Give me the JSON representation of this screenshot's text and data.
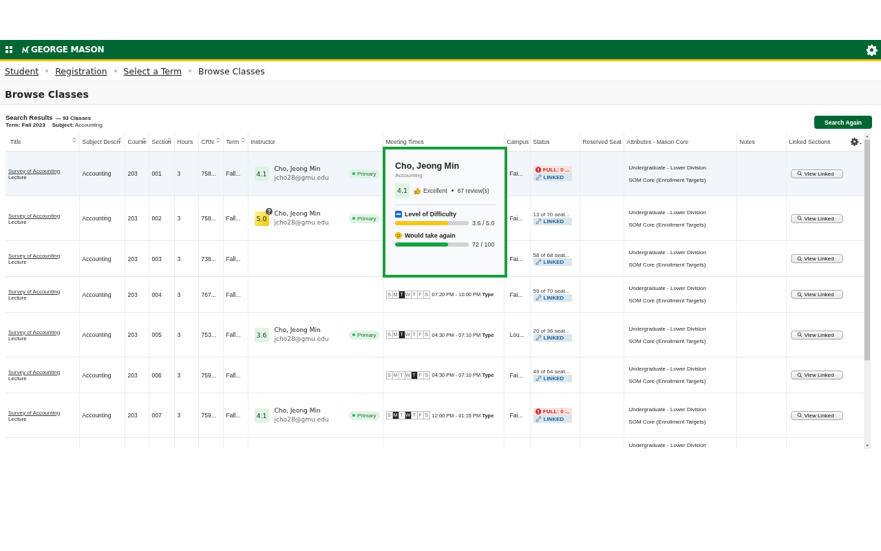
{
  "header": {
    "logo": "GEORGE MASON"
  },
  "breadcrumb": [
    {
      "label": "Student",
      "link": true
    },
    {
      "label": "Registration",
      "link": true
    },
    {
      "label": "Select a Term",
      "link": true
    },
    {
      "label": "Browse Classes",
      "link": false
    }
  ],
  "page_title": "Browse Classes",
  "results": {
    "title": "Search Results",
    "count": "— 93 Classes",
    "term": "Term: Fall 2023",
    "subject": "**Subject:** Accounting",
    "button": "Search Again"
  },
  "columns": [
    {
      "label": "Title",
      "sortable": true
    },
    {
      "label": "Subject Descri",
      "sortable": true
    },
    {
      "label": "Course",
      "sortable": true
    },
    {
      "label": "Section",
      "sortable": true
    },
    {
      "label": "Hours",
      "sortable": false
    },
    {
      "label": "CRN",
      "sortable": true
    },
    {
      "label": "Term",
      "sortable": true
    },
    {
      "label": "Instructor",
      "sortable": false
    },
    {
      "label": "Meeting Times",
      "sortable": false
    },
    {
      "label": "Campus",
      "sortable": false
    },
    {
      "label": "Status",
      "sortable": false
    },
    {
      "label": "Reserved Seat",
      "sortable": false
    },
    {
      "label": "Attributes - Mason Core",
      "sortable": false
    },
    {
      "label": "Notes",
      "sortable": false
    },
    {
      "label": "Linked Sections",
      "sortable": false
    }
  ],
  "rows": [
    {
      "selected": true,
      "title": "Survey of Accounting",
      "schedule": "Lecture",
      "subject": "Accounting",
      "course": "203",
      "section": "001",
      "hours": "3",
      "crn": "758...",
      "term": "Fall...",
      "instructor": {
        "rating": "4.1",
        "kind": "rated",
        "name": "Cho, Jeong Min",
        "email": "jcho28@gmu.edu",
        "role": "Primary"
      },
      "campus": "Fai...",
      "status": [
        {
          "kind": "full",
          "text": "FULL: 0 ..."
        },
        {
          "kind": "linked",
          "text": "LINKED"
        }
      ],
      "attributes": [
        "Undergraduate - Lower Division",
        "SOM Core (Enrollment Targets)"
      ],
      "linked": "View Linked"
    },
    {
      "selected": false,
      "title": "Survey of Accounting",
      "schedule": "Lecture",
      "subject": "Accounting",
      "course": "203",
      "section": "002",
      "hours": "3",
      "crn": "758...",
      "term": "Fall...",
      "instructor": {
        "rating": "5.0",
        "kind": "unverified",
        "name": "Cho, Jeong Min",
        "email": "jcho28@gmu.edu",
        "role": "Primary"
      },
      "campus": "Fai...",
      "status": [
        {
          "kind": "seats",
          "text": "13 of 70 seat..."
        },
        {
          "kind": "linked",
          "text": "LINKED"
        }
      ],
      "attributes": [
        "Undergraduate - Lower Division",
        "SOM Core (Enrollment Targets)"
      ],
      "linked": "View Linked"
    },
    {
      "selected": false,
      "title": "Survey of Accounting",
      "schedule": "Lecture",
      "subject": "Accounting",
      "course": "203",
      "section": "003",
      "hours": "3",
      "crn": "738...",
      "term": "Fall...",
      "campus": "Fai...",
      "status": [
        {
          "kind": "seats",
          "text": "58 of 68 seat..."
        },
        {
          "kind": "linked",
          "text": "LINKED"
        }
      ],
      "attributes": [
        "Undergraduate - Lower Division",
        "SOM Core (Enrollment Targets)"
      ],
      "linked": "View Linked"
    },
    {
      "selected": false,
      "title": "Survey of Accounting",
      "schedule": "Lecture",
      "subject": "Accounting",
      "course": "203",
      "section": "004",
      "hours": "3",
      "crn": "767...",
      "term": "Fall...",
      "meeting": {
        "days": [
          {
            "label": "S",
            "on": false
          },
          {
            "label": "M",
            "on": false
          },
          {
            "label": "T",
            "on": true
          },
          {
            "label": "W",
            "on": false
          },
          {
            "label": "T",
            "on": false
          },
          {
            "label": "F",
            "on": false
          },
          {
            "label": "S",
            "on": false
          }
        ],
        "time": "07:20 PM - 10:00 PM",
        "type": "Type"
      },
      "campus": "Fai...",
      "status": [
        {
          "kind": "seats",
          "text": "59 of 70 seat..."
        },
        {
          "kind": "linked",
          "text": "LINKED"
        }
      ],
      "attributes": [
        "Undergraduate - Lower Division",
        "SOM Core (Enrollment Targets)"
      ],
      "linked": "View Linked"
    },
    {
      "selected": false,
      "title": "Survey of Accounting",
      "schedule": "Lecture",
      "subject": "Accounting",
      "course": "203",
      "section": "005",
      "hours": "3",
      "crn": "753...",
      "term": "Fall...",
      "instructor": {
        "rating": "3.6",
        "kind": "rated",
        "name": "Cho, Jeong Min",
        "email": "jcho28@gmu.edu",
        "role": "Primary"
      },
      "meeting": {
        "days": [
          {
            "label": "S",
            "on": false
          },
          {
            "label": "M",
            "on": false
          },
          {
            "label": "T",
            "on": true
          },
          {
            "label": "W",
            "on": false
          },
          {
            "label": "T",
            "on": false
          },
          {
            "label": "F",
            "on": false
          },
          {
            "label": "S",
            "on": false
          }
        ],
        "time": "04:30 PM - 07:10 PM",
        "type": "Type"
      },
      "campus": "Lou...",
      "status": [
        {
          "kind": "seats",
          "text": "20 of 36 seat..."
        },
        {
          "kind": "linked",
          "text": "LINKED"
        }
      ],
      "attributes": [
        "Undergraduate - Lower Division",
        "SOM Core (Enrollment Targets)"
      ],
      "linked": "View Linked"
    },
    {
      "selected": false,
      "title": "Survey of Accounting",
      "schedule": "Lecture",
      "subject": "Accounting",
      "course": "203",
      "section": "006",
      "hours": "3",
      "crn": "759...",
      "term": "Fall...",
      "meeting": {
        "days": [
          {
            "label": "S",
            "on": false
          },
          {
            "label": "M",
            "on": false
          },
          {
            "label": "T",
            "on": false
          },
          {
            "label": "W",
            "on": false
          },
          {
            "label": "T",
            "on": true
          },
          {
            "label": "F",
            "on": false
          },
          {
            "label": "S",
            "on": false
          }
        ],
        "time": "04:30 PM - 07:10 PM",
        "type": "Type"
      },
      "campus": "Fai...",
      "status": [
        {
          "kind": "seats",
          "text": "49 of 64 seat..."
        },
        {
          "kind": "linked",
          "text": "LINKED"
        }
      ],
      "attributes": [
        "Undergraduate - Lower Division",
        "SOM Core (Enrollment Targets)"
      ],
      "linked": "View Linked"
    },
    {
      "selected": false,
      "title": "Survey of Accounting",
      "schedule": "Lecture",
      "subject": "Accounting",
      "course": "203",
      "section": "007",
      "hours": "3",
      "crn": "759...",
      "term": "Fall...",
      "instructor": {
        "rating": "4.1",
        "kind": "rated",
        "name": "Cho, Jeong Min",
        "email": "jcho28@gmu.edu",
        "role": "Primary"
      },
      "meeting": {
        "days": [
          {
            "label": "S",
            "on": false
          },
          {
            "label": "M",
            "on": true
          },
          {
            "label": "T",
            "on": false
          },
          {
            "label": "W",
            "on": true
          },
          {
            "label": "T",
            "on": false
          },
          {
            "label": "F",
            "on": false
          },
          {
            "label": "S",
            "on": false
          }
        ],
        "time": "12:00 PM - 01:15 PM",
        "type": "Type"
      },
      "campus": "Fai...",
      "status": [
        {
          "kind": "full",
          "text": "FULL: 0 ..."
        },
        {
          "kind": "linked",
          "text": "LINKED"
        }
      ],
      "attributes": [
        "Undergraduate - Lower Division",
        "SOM Core (Enrollment Targets)"
      ],
      "linked": "View Linked"
    },
    {
      "selected": false,
      "attributes": [
        "Undergraduate - Lower Division"
      ]
    }
  ],
  "popup": {
    "name": "Cho, Jeong Min",
    "department": "Accounting",
    "rating": "4.1",
    "verdict": "Excellent",
    "reviews": "67 review(s)",
    "metrics": [
      {
        "kind": "difficulty",
        "label": "Level of Difficulty",
        "level": 0.72,
        "reading": "3.6 / 5.0"
      },
      {
        "kind": "again",
        "label": "Would take again",
        "level": 0.72,
        "reading": "72 / 100"
      }
    ]
  }
}
